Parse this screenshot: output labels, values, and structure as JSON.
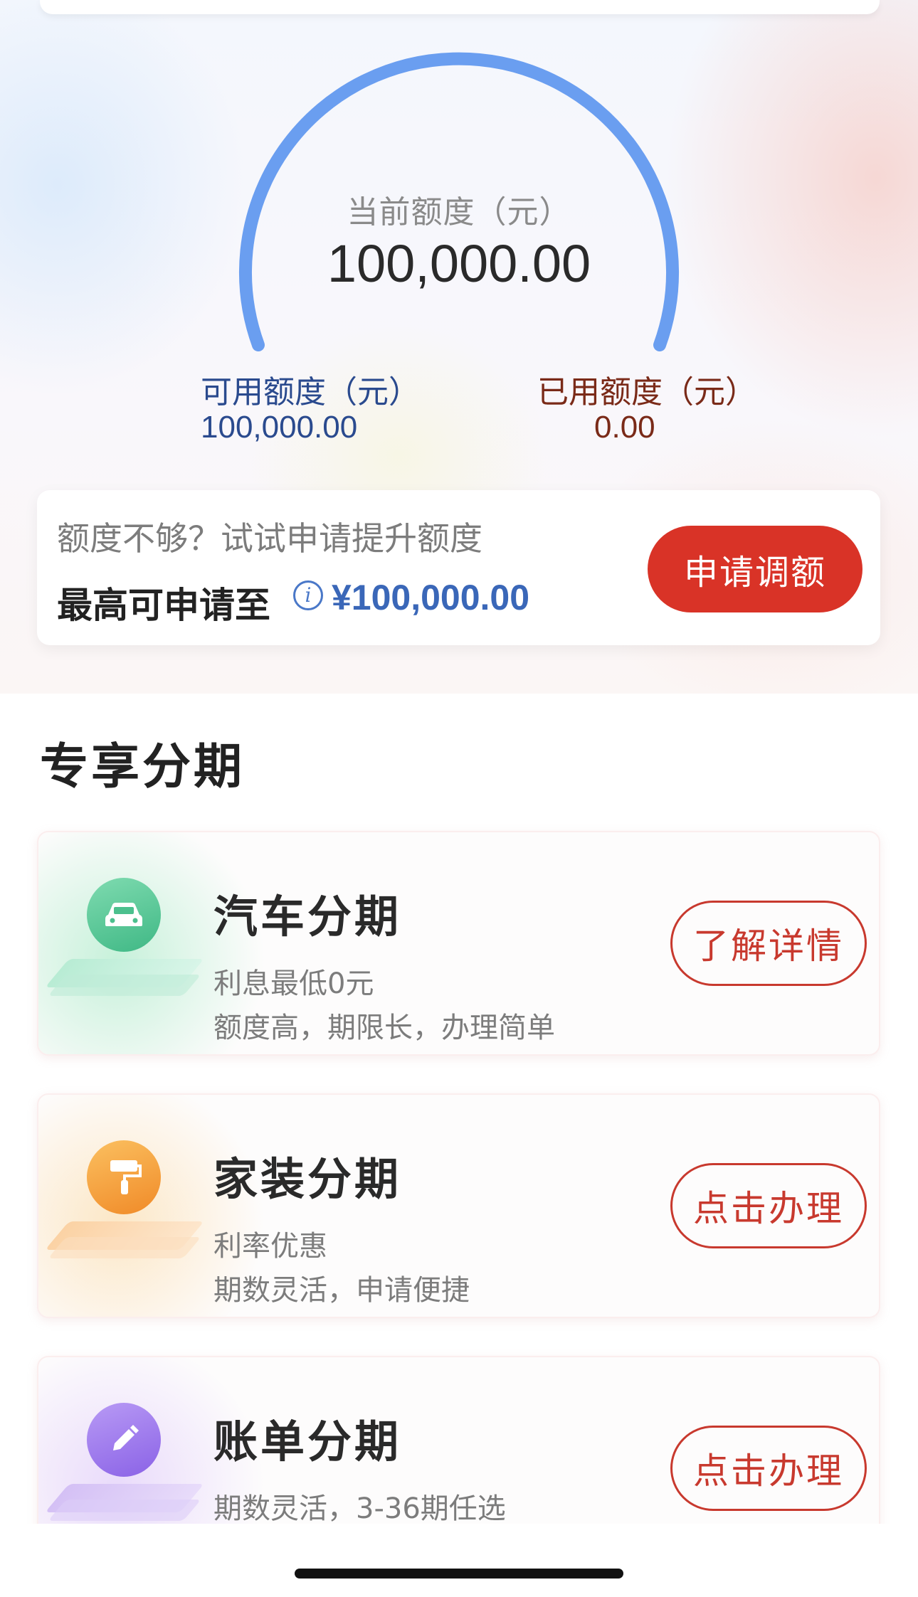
{
  "colors": {
    "gauge_arc": "#6a9ef0",
    "accent_red": "#d93327",
    "available_blue": "#2a4a8e",
    "used_brown": "#7a2a18",
    "max_value_blue": "#3a67b8"
  },
  "quota": {
    "current_label": "当前额度（元）",
    "current_value": "100,000.00",
    "available_label": "可用额度（元）",
    "available_value": "100,000.00",
    "used_label": "已用额度（元）",
    "used_value": "0.00"
  },
  "upgrade": {
    "tip": "额度不够？试试申请提升额度",
    "max_label": "最高可申请至",
    "info_icon": "info-icon",
    "max_value": "¥100,000.00",
    "button_label": "申请调额"
  },
  "section_title": "专享分期",
  "products": [
    {
      "icon": "car-icon",
      "title": "汽车分期",
      "desc1": "利息最低0元",
      "desc2": "额度高，期限长，办理简单",
      "button_label": "了解详情"
    },
    {
      "icon": "paint-roller-icon",
      "title": "家装分期",
      "desc1": "利率优惠",
      "desc2": "期数灵活，申请便捷",
      "button_label": "点击办理"
    },
    {
      "icon": "pencil-icon",
      "title": "账单分期",
      "desc1": "期数灵活，3-36期任选",
      "desc2": "",
      "button_label": "点击办理"
    }
  ]
}
